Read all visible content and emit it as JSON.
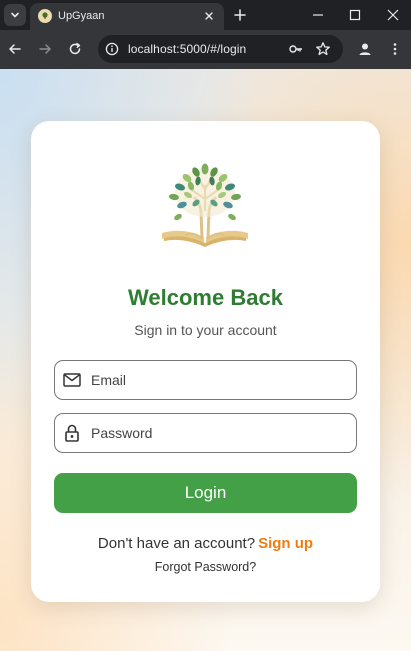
{
  "browser": {
    "tab_title": "UpGyaan",
    "url": "localhost:5000/#/login"
  },
  "login": {
    "title": "Welcome Back",
    "subtitle": "Sign in to your account",
    "email_placeholder": "Email",
    "password_placeholder": "Password",
    "login_label": "Login",
    "signup_prompt": "Don't have an account?",
    "signup_link": "Sign up",
    "forgot_label": "Forgot Password?"
  },
  "colors": {
    "brand_green": "#2e7d32",
    "button_green": "#43a047",
    "signup_orange": "#ef7d12"
  },
  "icons": [
    "tab-menu-icon",
    "favicon-icon",
    "close-icon",
    "plus-icon",
    "minimize-icon",
    "maximize-icon",
    "back-icon",
    "forward-icon",
    "reload-icon",
    "info-icon",
    "key-icon",
    "star-icon",
    "profile-icon",
    "more-icon",
    "tree-book-logo-icon",
    "mail-icon",
    "lock-icon"
  ]
}
